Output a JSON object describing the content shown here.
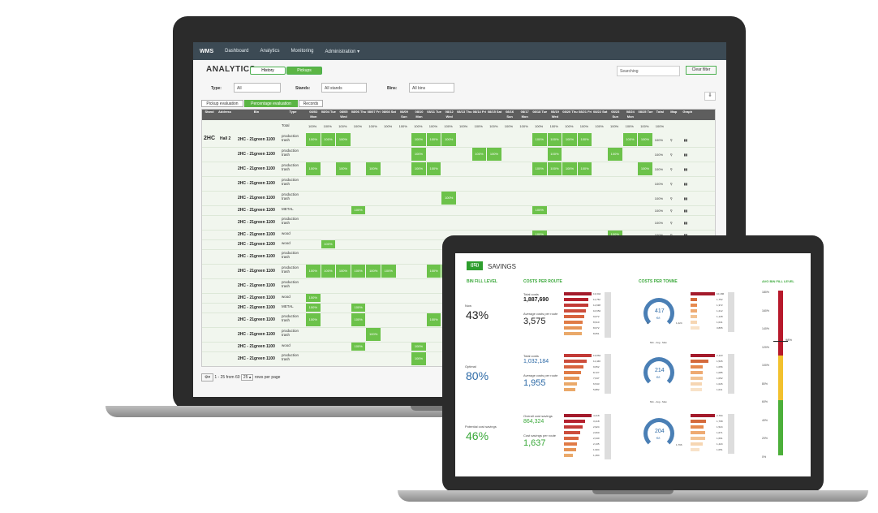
{
  "nav": {
    "logo": "WMS",
    "items": [
      "Dashboard",
      "Analytics",
      "Monitoring",
      "Administration ▾"
    ]
  },
  "analytics": {
    "title": "ANALYTICS",
    "toggles": [
      "History",
      "Pickups"
    ],
    "search_placeholder": "Searching",
    "clear_filter": "Clear filter",
    "filters": {
      "type_label": "Type:",
      "type_value": "All",
      "stands_label": "Stands:",
      "stands_value": "All stands",
      "bins_label": "Bins:",
      "bins_value": "All bins"
    },
    "tabs": [
      "Pickup evaluation",
      "Percentage evaluation",
      "Records"
    ],
    "columns": [
      "Stand",
      "Address",
      "Bin",
      "Type",
      "08/02 Mon",
      "08/04 Tue",
      "08/05 Wed",
      "08/06 Thu",
      "08/07 Fri",
      "08/08 Sat",
      "08/09 Sun",
      "08/10 Mon",
      "08/11 Tue",
      "08/12 Wed",
      "08/13 Thu",
      "08/14 Fri",
      "08/15 Sat",
      "08/16 Sun",
      "08/17 Mon",
      "08/18 Tue",
      "08/19 Wed",
      "08/20 Thu",
      "08/21 Fri",
      "08/22 Sat",
      "08/23 Sun",
      "08/24 Mon",
      "08/25 Tue",
      "Total",
      "Map",
      "Graph"
    ],
    "total_label": "Total",
    "stand": "2HC",
    "address": "Hall 2",
    "pct": "100%",
    "bin": "2HC - 21green 1100",
    "types": [
      "production trash",
      "production trash",
      "production trash",
      "production trash",
      "production trash",
      "METAL",
      "production trash",
      "wood",
      "wood",
      "production trash",
      "production trash",
      "production trash",
      "wood",
      "METAL",
      "production trash",
      "production trash",
      "wood",
      "production trash"
    ],
    "footer": {
      "range": "1 - 25 from 60",
      "per_page": "25 ▴",
      "rows_label": "rows per page"
    }
  },
  "savings": {
    "logo": "((S))",
    "title": "SAVINGS",
    "bin_fill_title": "BIN FILL LEVEL",
    "costs_route_title": "COSTS PER ROUTE",
    "costs_tonne_title": "COSTS PER TONNE",
    "avg_fill_title": "AVG BIN FILL LEVEL",
    "now_label": "Now",
    "now_value": "43%",
    "optimal_label": "Optimal",
    "optimal_value": "80%",
    "potential_label": "Potential cost savings",
    "potential_value": "46%",
    "route1": {
      "total_label": "Total costs",
      "total": "1,887,690",
      "avg_label": "Average costs per route",
      "avg": "3,575"
    },
    "route2": {
      "total_label": "Total costs",
      "total": "1,032,184",
      "avg_label": "Average costs per route",
      "avg": "1,955"
    },
    "route3": {
      "total_label": "Overall cost savings",
      "total": "864,324",
      "avg_label": "Cost savings per route",
      "avg": "1,637"
    },
    "gauge1": {
      "value": "417",
      "unit": "€/t",
      "min": "0",
      "max": "1,424"
    },
    "gauge2": {
      "value": "214",
      "unit": "€/t"
    },
    "gauge3": {
      "value": "204",
      "unit": "€/t",
      "max": "1,796"
    },
    "minavgmax": "Min - Avg - Max",
    "bars1": [
      "13,344",
      "11,752",
      "11,638",
      "10,652",
      "9,672",
      "8,910",
      "8,672",
      "8,651"
    ],
    "bars2": [
      "13,862",
      "11,440",
      "9,652",
      "8,727",
      "7,647",
      "6,543",
      "5,882"
    ],
    "bars3": [
      "4,418",
      "3,418",
      "2,924",
      "2,660",
      "2,340",
      "2,135",
      "1,904",
      "1,494"
    ],
    "tbars1": [
      "10,186",
      "1,752",
      "1,372",
      "1,212",
      "1,128",
      "1,041",
      "3,865"
    ],
    "tbars2": [
      "2,123",
      "1,526",
      "1,056",
      "1,085",
      "1,052",
      "1,026",
      "1,011"
    ],
    "tbars3": [
      "2,794",
      "1,768",
      "1,524",
      "1,671",
      "1,691",
      "1,424",
      "1,051"
    ],
    "avg_ticks": [
      "180%",
      "160%",
      "140%",
      "120%",
      "100%",
      "80%",
      "60%",
      "40%",
      "20%",
      "0%"
    ],
    "avg_marker": "98%"
  }
}
